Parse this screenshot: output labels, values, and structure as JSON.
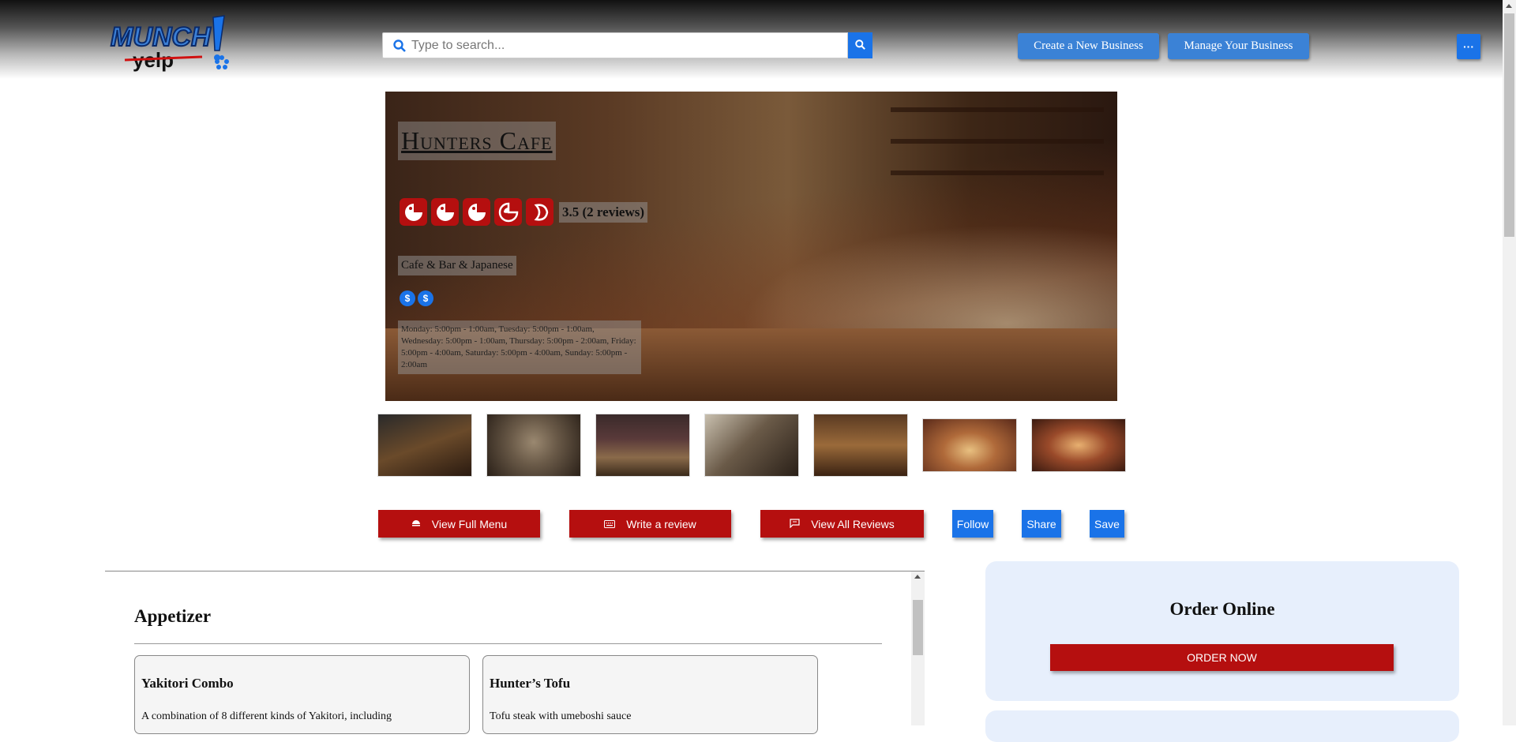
{
  "header": {
    "search_placeholder": "Type to search...",
    "create_business_label": "Create a New Business",
    "manage_business_label": "Manage Your Business",
    "more_label": "···",
    "logo_word_top": "MUNCH",
    "logo_word_bottom": "yelp"
  },
  "business": {
    "name": "Hunters Cafe",
    "rating_text": "3.5 (2 reviews)",
    "rating_value": 3.5,
    "rating_max": 5,
    "categories": "Cafe & Bar & Japanese",
    "price_symbols": [
      "$",
      "$"
    ],
    "hours": "Monday: 5:00pm - 1:00am, Tuesday: 5:00pm - 1:00am, Wednesday: 5:00pm - 1:00am, Thursday: 5:00pm - 2:00am, Friday: 5:00pm - 4:00am, Saturday: 5:00pm - 4:00am, Sunday: 5:00pm - 2:00am"
  },
  "gallery": {
    "thumbnail_count": 7
  },
  "actions": {
    "view_menu": "View Full Menu",
    "write_review": "Write a review",
    "view_reviews": "View All Reviews",
    "follow": "Follow",
    "share": "Share",
    "save": "Save"
  },
  "menu": {
    "section_title": "Appetizer",
    "items": [
      {
        "name": "Yakitori Combo",
        "description": "A combination of 8 different kinds of Yakitori, including"
      },
      {
        "name": "Hunter’s Tofu",
        "description": "Tofu steak with umeboshi sauce"
      }
    ]
  },
  "order": {
    "title": "Order Online",
    "button_label": "ORDER NOW"
  },
  "colors": {
    "brand_red": "#b50f0f",
    "brand_blue": "#1a73e8",
    "order_panel_bg": "#e7effc"
  }
}
